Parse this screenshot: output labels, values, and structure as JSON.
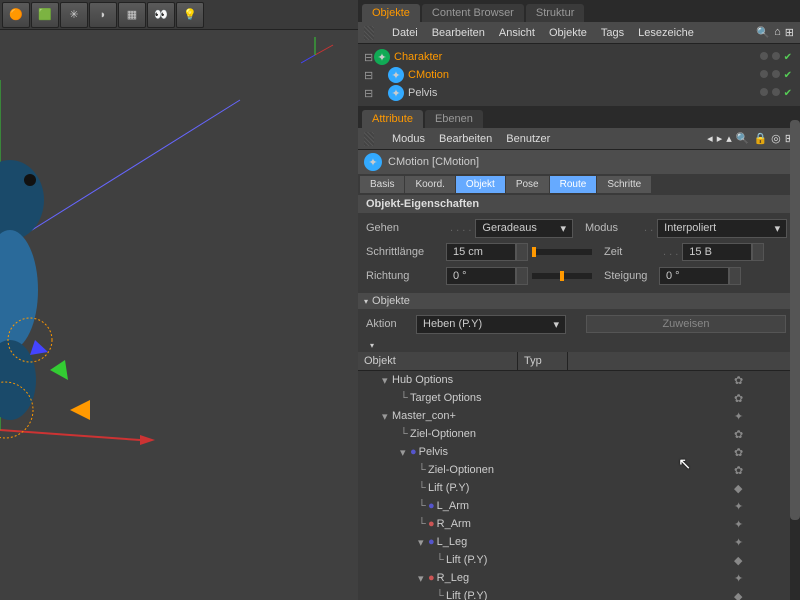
{
  "toolbar_icons": [
    "snake",
    "cube",
    "flower",
    "bevel",
    "grid",
    "camera",
    "light"
  ],
  "objects_panel": {
    "tabs": [
      "Objekte",
      "Content Browser",
      "Struktur"
    ],
    "active_tab": 0,
    "menu": [
      "Datei",
      "Bearbeiten",
      "Ansicht",
      "Objekte",
      "Tags",
      "Lesezeiche"
    ],
    "tree": [
      {
        "indent": 0,
        "label": "Charakter",
        "hl": true
      },
      {
        "indent": 1,
        "label": "CMotion",
        "hl": true
      },
      {
        "indent": 1,
        "label": "Pelvis",
        "hl": false
      }
    ]
  },
  "attr_panel": {
    "tabs": [
      "Attribute",
      "Ebenen"
    ],
    "active_tab": 0,
    "menu": [
      "Modus",
      "Bearbeiten",
      "Benutzer"
    ],
    "title": "CMotion [CMotion]",
    "sub_tabs": [
      "Basis",
      "Koord.",
      "Objekt",
      "Pose",
      "Route",
      "Schritte"
    ],
    "active_sub": [
      2,
      4
    ],
    "section": "Objekt-Eigenschaften",
    "props": {
      "gehen": {
        "label": "Gehen",
        "value": "Geradeaus"
      },
      "modus": {
        "label": "Modus",
        "value": "Interpoliert"
      },
      "schrittlange": {
        "label": "Schrittlänge",
        "value": "15 cm"
      },
      "zeit": {
        "label": "Zeit",
        "value": "15 B"
      },
      "richtung": {
        "label": "Richtung",
        "value": "0 °"
      },
      "steigung": {
        "label": "Steigung",
        "value": "0 °"
      }
    },
    "objekte_section": "Objekte",
    "aktion": {
      "label": "Aktion",
      "value": "Heben (P.Y)"
    },
    "zuweisen": "Zuweisen",
    "table_head": {
      "col1": "Objekt",
      "col2": "Typ"
    },
    "obj_tree": [
      {
        "indent": 0,
        "label": "Hub Options",
        "hl": false,
        "icon": "gear"
      },
      {
        "indent": 1,
        "label": "Target Options",
        "hl": false,
        "icon": "gear"
      },
      {
        "indent": 0,
        "label": "Master_con+",
        "hl": false,
        "icon": "sparkle"
      },
      {
        "indent": 1,
        "label": "Ziel-Optionen",
        "hl": false,
        "icon": "gear"
      },
      {
        "indent": 1,
        "label": "Pelvis",
        "hl": false,
        "icon": "gear",
        "joint": true
      },
      {
        "indent": 2,
        "label": "Ziel-Optionen",
        "hl": false,
        "icon": "gear"
      },
      {
        "indent": 2,
        "label": "Lift (P.Y)",
        "hl": false,
        "icon": "diamond"
      },
      {
        "indent": 2,
        "label": "L_Arm",
        "hl": false,
        "icon": "sparkle",
        "joint": true
      },
      {
        "indent": 2,
        "label": "R_Arm",
        "hl": false,
        "icon": "sparkle",
        "joint": true
      },
      {
        "indent": 2,
        "label": "L_Leg",
        "hl": false,
        "icon": "sparkle",
        "joint": true
      },
      {
        "indent": 3,
        "label": "Lift (P.Y)",
        "hl": true,
        "icon": "diamond"
      },
      {
        "indent": 2,
        "label": "R_Leg",
        "hl": false,
        "icon": "sparkle",
        "joint": true
      },
      {
        "indent": 3,
        "label": "Lift (P.Y)",
        "hl": true,
        "icon": "diamond"
      }
    ]
  }
}
